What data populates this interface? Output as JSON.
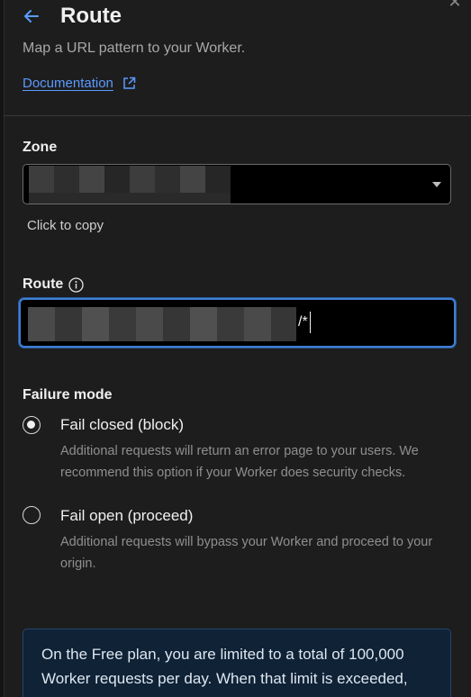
{
  "header": {
    "title": "Route",
    "subtitle": "Map a URL pattern to your Worker.",
    "documentation_link": "Documentation"
  },
  "zone": {
    "label": "Zone",
    "value": "",
    "copy_hint": "Click to copy"
  },
  "route": {
    "label": "Route",
    "value_suffix": "/*"
  },
  "failure_mode": {
    "label": "Failure mode",
    "options": [
      {
        "title": "Fail closed (block)",
        "description": "Additional requests will return an error page to your users. We recommend this option if your Worker does security checks.",
        "selected": true
      },
      {
        "title": "Fail open (proceed)",
        "description": "Additional requests will bypass your Worker and proceed to your origin.",
        "selected": false
      }
    ]
  },
  "notice": {
    "text": "On the Free plan, you are limited to a total of 100,000 Worker requests per day. When that limit is exceeded, requests to your route will fail, depending on the failure mode selected."
  },
  "colors": {
    "background": "#1d1d1d",
    "accent": "#5b9bff",
    "focus_border": "#3f7fd4",
    "notice_background": "#0f2236"
  },
  "icons": {
    "back": "arrow-left-icon",
    "external": "external-link-icon",
    "info": "info-icon",
    "dropdown": "chevron-down-icon",
    "close": "close-icon"
  }
}
